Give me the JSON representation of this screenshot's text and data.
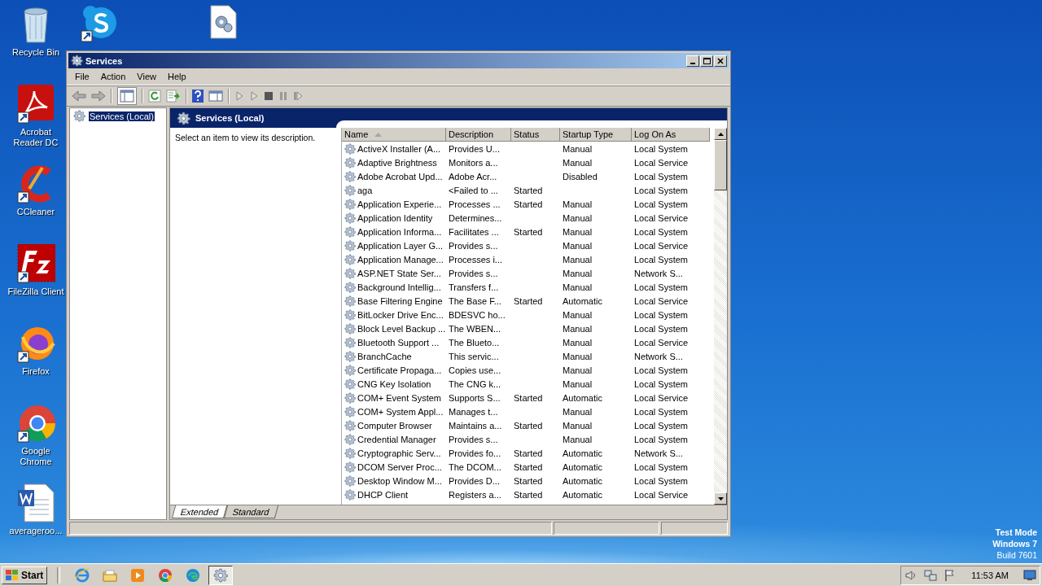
{
  "desktop_icons": [
    {
      "kind": "recycle",
      "label": "Recycle Bin"
    },
    {
      "kind": "skype"
    },
    {
      "kind": "services-file"
    },
    {
      "kind": "acrobat",
      "label": "Acrobat Reader DC"
    },
    {
      "kind": "ccleaner",
      "label": "CCleaner"
    },
    {
      "kind": "filezilla",
      "label": "FileZilla Client"
    },
    {
      "kind": "firefox",
      "label": "Firefox"
    },
    {
      "kind": "chrome",
      "label": "Google Chrome"
    },
    {
      "kind": "word",
      "label": "averageroo..."
    }
  ],
  "window": {
    "title": "Services",
    "menu": [
      "File",
      "Action",
      "View",
      "Help"
    ],
    "tree": [
      {
        "label": "Services (Local)",
        "selected": true
      }
    ],
    "pane_title": "Services (Local)",
    "description_hint": "Select an item to view its description.",
    "columns": [
      {
        "label": "Name",
        "sorted": true
      },
      {
        "label": "Description",
        "sorted": false
      },
      {
        "label": "Status",
        "sorted": false
      },
      {
        "label": "Startup Type",
        "sorted": false
      },
      {
        "label": "Log On As",
        "sorted": false
      }
    ],
    "rows": [
      {
        "name": "ActiveX Installer (A...",
        "description": "Provides U...",
        "status": "",
        "startup_type": "Manual",
        "log_on_as": "Local System"
      },
      {
        "name": "Adaptive Brightness",
        "description": "Monitors a...",
        "status": "",
        "startup_type": "Manual",
        "log_on_as": "Local Service"
      },
      {
        "name": "Adobe Acrobat Upd...",
        "description": "Adobe Acr...",
        "status": "",
        "startup_type": "Disabled",
        "log_on_as": "Local System"
      },
      {
        "name": "aga",
        "description": "<Failed to ...",
        "status": "Started",
        "startup_type": "",
        "log_on_as": "Local System"
      },
      {
        "name": "Application Experie...",
        "description": "Processes ...",
        "status": "Started",
        "startup_type": "Manual",
        "log_on_as": "Local System"
      },
      {
        "name": "Application Identity",
        "description": "Determines...",
        "status": "",
        "startup_type": "Manual",
        "log_on_as": "Local Service"
      },
      {
        "name": "Application Informa...",
        "description": "Facilitates ...",
        "status": "Started",
        "startup_type": "Manual",
        "log_on_as": "Local System"
      },
      {
        "name": "Application Layer G...",
        "description": "Provides s...",
        "status": "",
        "startup_type": "Manual",
        "log_on_as": "Local Service"
      },
      {
        "name": "Application Manage...",
        "description": "Processes i...",
        "status": "",
        "startup_type": "Manual",
        "log_on_as": "Local System"
      },
      {
        "name": "ASP.NET State Ser...",
        "description": "Provides s...",
        "status": "",
        "startup_type": "Manual",
        "log_on_as": "Network S..."
      },
      {
        "name": "Background Intellig...",
        "description": "Transfers f...",
        "status": "",
        "startup_type": "Manual",
        "log_on_as": "Local System"
      },
      {
        "name": "Base Filtering Engine",
        "description": "The Base F...",
        "status": "Started",
        "startup_type": "Automatic",
        "log_on_as": "Local Service"
      },
      {
        "name": "BitLocker Drive Enc...",
        "description": "BDESVC ho...",
        "status": "",
        "startup_type": "Manual",
        "log_on_as": "Local System"
      },
      {
        "name": "Block Level Backup ...",
        "description": "The WBEN...",
        "status": "",
        "startup_type": "Manual",
        "log_on_as": "Local System"
      },
      {
        "name": "Bluetooth Support ...",
        "description": "The Blueto...",
        "status": "",
        "startup_type": "Manual",
        "log_on_as": "Local Service"
      },
      {
        "name": "BranchCache",
        "description": "This servic...",
        "status": "",
        "startup_type": "Manual",
        "log_on_as": "Network S..."
      },
      {
        "name": "Certificate Propaga...",
        "description": "Copies use...",
        "status": "",
        "startup_type": "Manual",
        "log_on_as": "Local System"
      },
      {
        "name": "CNG Key Isolation",
        "description": "The CNG k...",
        "status": "",
        "startup_type": "Manual",
        "log_on_as": "Local System"
      },
      {
        "name": "COM+ Event System",
        "description": "Supports S...",
        "status": "Started",
        "startup_type": "Automatic",
        "log_on_as": "Local Service"
      },
      {
        "name": "COM+ System Appl...",
        "description": "Manages t...",
        "status": "",
        "startup_type": "Manual",
        "log_on_as": "Local System"
      },
      {
        "name": "Computer Browser",
        "description": "Maintains a...",
        "status": "Started",
        "startup_type": "Manual",
        "log_on_as": "Local System"
      },
      {
        "name": "Credential Manager",
        "description": "Provides s...",
        "status": "",
        "startup_type": "Manual",
        "log_on_as": "Local System"
      },
      {
        "name": "Cryptographic Serv...",
        "description": "Provides fo...",
        "status": "Started",
        "startup_type": "Automatic",
        "log_on_as": "Network S..."
      },
      {
        "name": "DCOM Server Proc...",
        "description": "The DCOM...",
        "status": "Started",
        "startup_type": "Automatic",
        "log_on_as": "Local System"
      },
      {
        "name": "Desktop Window M...",
        "description": "Provides D...",
        "status": "Started",
        "startup_type": "Automatic",
        "log_on_as": "Local System"
      },
      {
        "name": "DHCP Client",
        "description": "Registers a...",
        "status": "Started",
        "startup_type": "Automatic",
        "log_on_as": "Local Service"
      }
    ],
    "tabs": [
      {
        "label": "Extended",
        "selected": true
      },
      {
        "label": "Standard",
        "selected": false
      }
    ]
  },
  "taskbar": {
    "start_label": "Start",
    "apps": [
      {
        "kind": "ie",
        "selected": false
      },
      {
        "kind": "explorer",
        "selected": false
      },
      {
        "kind": "media",
        "selected": false
      },
      {
        "kind": "chrome",
        "selected": false
      },
      {
        "kind": "edge",
        "selected": false
      },
      {
        "kind": "services",
        "selected": true
      }
    ],
    "clock": "11:53 AM"
  },
  "os_notice": [
    "Test Mode",
    "Windows 7",
    "Build 7601"
  ]
}
